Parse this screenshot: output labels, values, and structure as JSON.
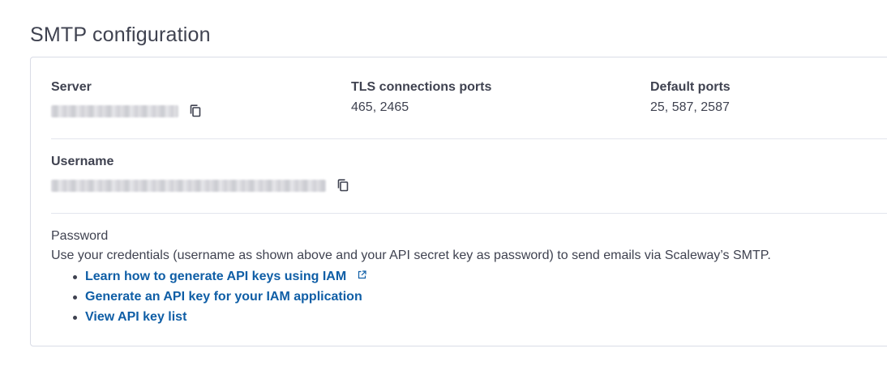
{
  "page": {
    "title": "SMTP configuration"
  },
  "config": {
    "server": {
      "label": "Server"
    },
    "tls_ports": {
      "label": "TLS connections ports",
      "value": "465, 2465"
    },
    "default_ports": {
      "label": "Default ports",
      "value": "25, 587, 2587"
    },
    "username": {
      "label": "Username"
    },
    "password": {
      "label": "Password",
      "description": "Use your credentials (username as shown above and your API secret key as password) to send emails via Scaleway’s SMTP.",
      "links": [
        {
          "label": "Learn how to generate API keys using IAM",
          "icon": "external-link-icon"
        },
        {
          "label": "Generate an API key for your IAM application"
        },
        {
          "label": "View API key list"
        }
      ]
    }
  },
  "icons": {
    "copy": "copy-icon",
    "external": "external-link-icon"
  },
  "colors": {
    "text": "#3f4250",
    "link": "#0f5ea6",
    "border": "#d9dce6"
  }
}
